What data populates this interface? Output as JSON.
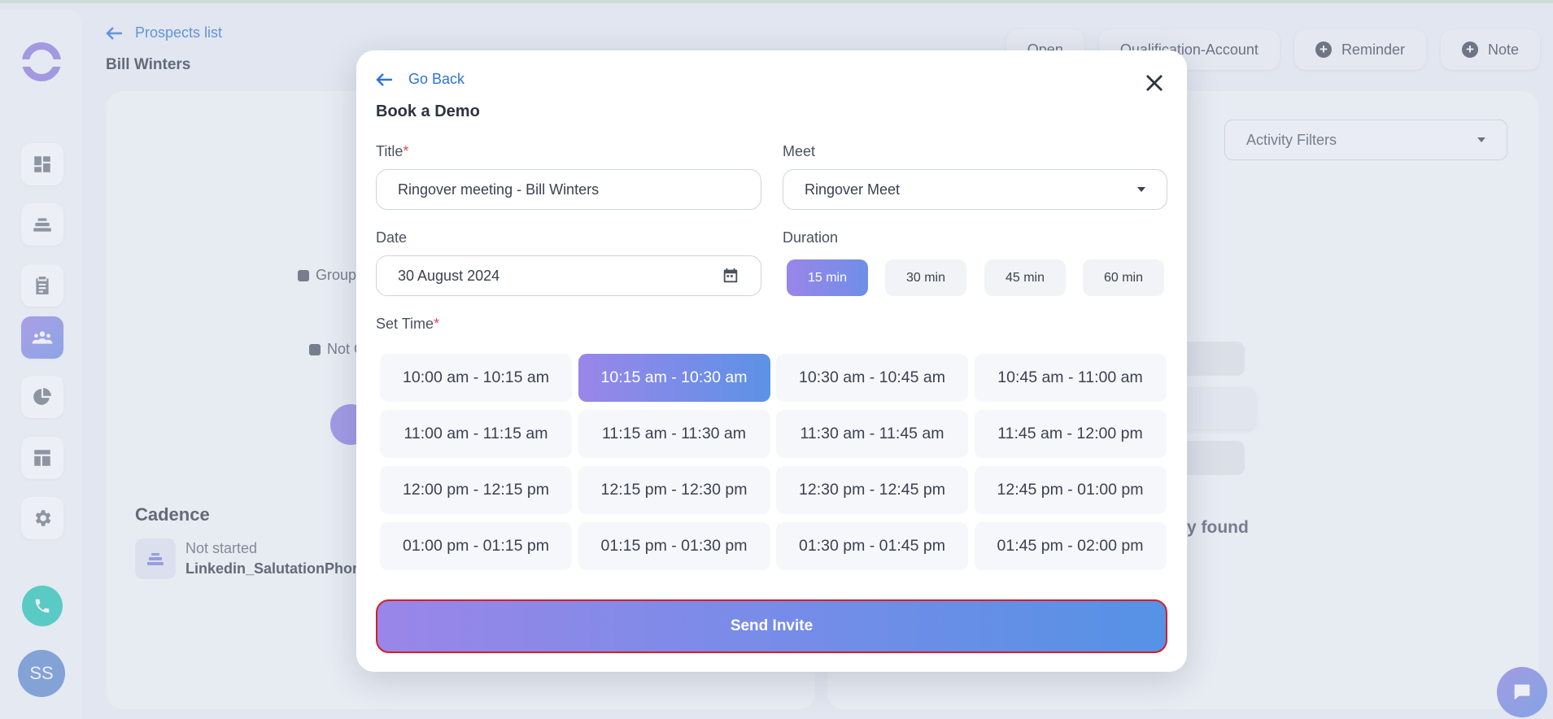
{
  "breadcrumb": {
    "label": "Prospects list"
  },
  "prospect": {
    "name": "Bill Winters"
  },
  "top_actions": {
    "status": "Open",
    "stage": "Qualification-Account",
    "reminder": "Reminder",
    "note": "Note"
  },
  "background": {
    "group_label": "Group",
    "not_label": "Not C",
    "activity_filters": "Activity Filters",
    "cadence_title": "Cadence",
    "cadence_status": "Not started",
    "cadence_name": "Linkedin_SalutationPhon",
    "empty_activity_text": "ty found"
  },
  "sidebar": {
    "avatar_initials": "SS",
    "items": [
      "dashboard-icon",
      "layers-icon",
      "clipboard-icon",
      "people-icon",
      "pie-chart-icon",
      "layout-icon",
      "settings-icon"
    ],
    "active_index": 3
  },
  "modal": {
    "go_back": "Go Back",
    "title": "Book a Demo",
    "title_label": "Title",
    "title_value": "Ringover meeting - Bill Winters",
    "meet_label": "Meet",
    "meet_value": "Ringover Meet",
    "date_label": "Date",
    "date_value": "30 August 2024",
    "duration_label": "Duration",
    "durations": [
      "15 min",
      "30 min",
      "45 min",
      "60 min"
    ],
    "selected_duration": "15 min",
    "set_time_label": "Set Time",
    "required_mark": "*",
    "time_slots": [
      "10:00 am - 10:15 am",
      "10:15 am - 10:30 am",
      "10:30 am - 10:45 am",
      "10:45 am - 11:00 am",
      "11:00 am - 11:15 am",
      "11:15 am - 11:30 am",
      "11:30 am - 11:45 am",
      "11:45 am - 12:00 pm",
      "12:00 pm - 12:15 pm",
      "12:15 pm - 12:30 pm",
      "12:30 pm - 12:45 pm",
      "12:45 pm - 01:00 pm",
      "01:00 pm - 01:15 pm",
      "01:15 pm - 01:30 pm",
      "01:30 pm - 01:45 pm",
      "01:45 pm - 02:00 pm"
    ],
    "selected_slot": "10:15 am - 10:30 am",
    "send_label": "Send Invite"
  },
  "colors": {
    "accent_gradient_start": "#9a86e9",
    "accent_gradient_end": "#5592e6",
    "link": "#2d73d6",
    "send_border": "#d21f2a",
    "call": "#1fc6b6"
  }
}
